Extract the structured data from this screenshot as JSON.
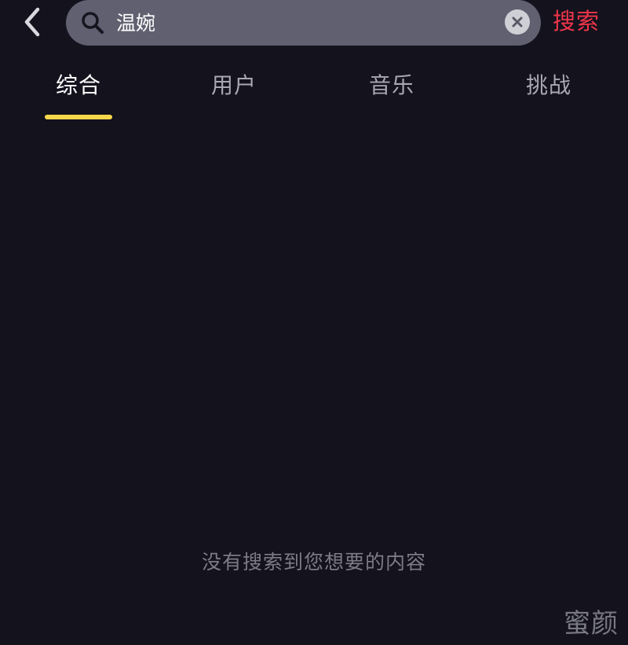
{
  "header": {
    "back_icon": "chevron-left-icon",
    "search": {
      "value": "温婉",
      "placeholder": "",
      "icon": "search-icon",
      "clear_icon": "clear-icon"
    },
    "submit_label": "搜索"
  },
  "tabs": [
    {
      "label": "综合",
      "active": true
    },
    {
      "label": "用户",
      "active": false
    },
    {
      "label": "音乐",
      "active": false
    },
    {
      "label": "挑战",
      "active": false
    }
  ],
  "empty_state": {
    "message": "没有搜索到您想要的内容"
  },
  "watermark": "蜜颜",
  "colors": {
    "background": "#13121d",
    "search_bar": "#616070",
    "submit_text": "#f0354b",
    "active_tab": "#ffffff",
    "inactive_tab": "#a9a8b2",
    "tab_indicator": "#fad74a",
    "empty_text": "#7c7b86"
  }
}
